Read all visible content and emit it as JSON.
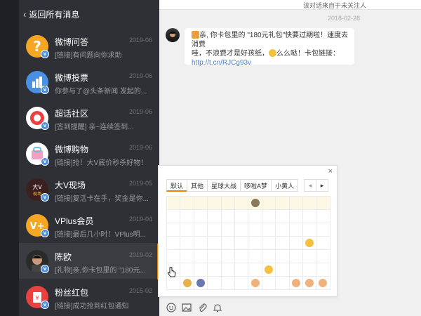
{
  "sidebar": {
    "back_label": "返回所有消息",
    "items": [
      {
        "name": "微博问答",
        "date": "2019-06",
        "preview": "[链接]有问题向你求助",
        "avatar_color": "#f5a623"
      },
      {
        "name": "微博投票",
        "date": "2019-06",
        "preview": "你参与了@头条新闻 发起的...",
        "avatar_color": "#4a90e2"
      },
      {
        "name": "超话社区",
        "date": "2019-06",
        "preview": "[签到提醒] 亲~连续签到...",
        "avatar_color": "#ffffff"
      },
      {
        "name": "微博购物",
        "date": "2019-06",
        "preview": "[链接]抢！大V底价秒杀好物！",
        "avatar_color": "#ffffff"
      },
      {
        "name": "大V现场",
        "date": "2019-05",
        "preview": "[链接]复活卡在手，奖金是你...",
        "avatar_color": "#3c1f1f"
      },
      {
        "name": "VPlus会员",
        "date": "2019-04",
        "preview": "[链接]最后几小时！VPlus明...",
        "avatar_color": "#f5a623"
      },
      {
        "name": "陈欧",
        "date": "2019-02",
        "preview": "[礼物]亲,你卡包里的 \"180元...",
        "avatar_color": "#2a2a2a"
      },
      {
        "name": "粉丝红包",
        "date": "2015-02",
        "preview": "[链接]成功抢到红包通知",
        "avatar_color": "#e94040"
      }
    ]
  },
  "chat": {
    "top_notice": "该对话来自于未关注人",
    "date": "2018-02-28",
    "message_line1": "亲, 你卡包里的 \"180元礼包\"快要过期啦！速度去消费",
    "message_line2": "哇，不浪费才是好孩纸，",
    "message_line2b": "么么哒！卡包链接：",
    "message_link": "http://t.cn/RJCg93v"
  },
  "emoji_panel": {
    "close_label": "×",
    "tabs": [
      "默认",
      "其他",
      "星球大战",
      "哆啦A梦",
      "小黄人"
    ],
    "prev_label": "◂",
    "next_label": "▸"
  },
  "toolbar": {
    "icons": [
      "emoji-icon",
      "image-icon",
      "attachment-icon",
      "bell-icon"
    ]
  },
  "colors": {
    "sidebar_bg": "#2f3035",
    "accent": "#f08200",
    "link": "#4a7dc9"
  }
}
